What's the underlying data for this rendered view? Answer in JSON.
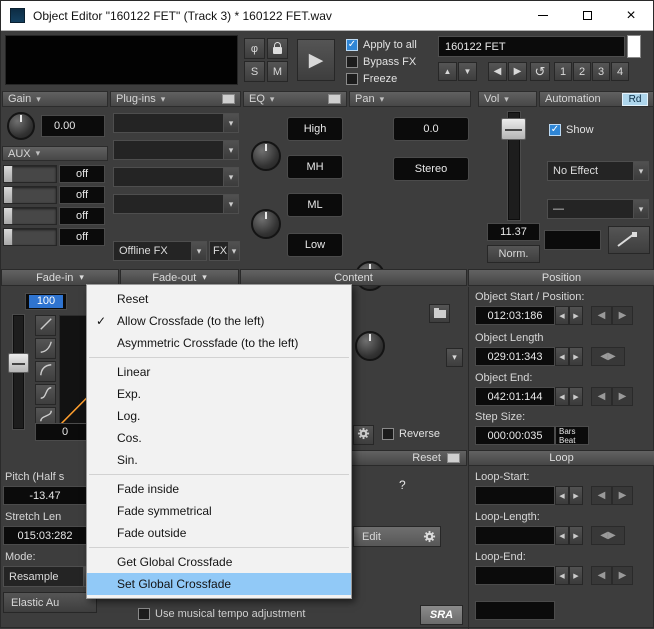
{
  "window": {
    "title": "Object Editor \"160122 FET\"  (Track 3) *   160122 FET.wav"
  },
  "icons": {
    "chevron_down": "▾",
    "check": "✓",
    "play": "▶",
    "arrow_up": "▲",
    "arrow_down": "▼",
    "arrow_left": "◀",
    "arrow_right": "▶",
    "undo": "↺",
    "move_both": "◀▶",
    "close": "×"
  },
  "transport": {
    "phase": "φ",
    "solo": "S",
    "mute": "M",
    "apply_to_all": "Apply to all",
    "bypass_fx": "Bypass FX",
    "freeze": "Freeze",
    "object_name": "160122 FET",
    "presets": [
      "1",
      "2",
      "3",
      "4"
    ]
  },
  "gain": {
    "label": "Gain",
    "value": "0.00"
  },
  "aux": {
    "label": "AUX",
    "sends": [
      "off",
      "off",
      "off",
      "off"
    ]
  },
  "plugins": {
    "label": "Plug-ins",
    "offline_fx": "Offline FX",
    "fx": "FX"
  },
  "eq": {
    "label": "EQ",
    "bands": [
      "High",
      "MH",
      "ML",
      "Low"
    ]
  },
  "pan": {
    "label": "Pan",
    "value": "0.0",
    "mode": "Stereo"
  },
  "vol": {
    "label": "Vol",
    "value": "11.37",
    "norm": "Norm."
  },
  "automation": {
    "label": "Automation",
    "read": "Rd",
    "show": "Show",
    "effect": "No Effect",
    "curve": "—"
  },
  "sections": {
    "fade_in": "Fade-in",
    "fade_out": "Fade-out",
    "content": "Content",
    "position": "Position",
    "loop": "Loop",
    "reset": "Reset"
  },
  "fade": {
    "in_value": "100",
    "out_value": "0",
    "reverse": "Reverse"
  },
  "context_menu": {
    "items": [
      "Reset",
      "Allow Crossfade (to the left)",
      "Asymmetric Crossfade (to the left)",
      "Linear",
      "Exp.",
      "Log.",
      "Cos.",
      "Sin.",
      "Fade inside",
      "Fade symmetrical",
      "Fade outside",
      "Get Global Crossfade",
      "Set Global Crossfade"
    ]
  },
  "position_panel": {
    "object_start_label": "Object Start / Position:",
    "object_start": "012:03:186",
    "object_length_label": "Object Length",
    "object_length": "029:01:343",
    "object_end_label": "Object End:",
    "object_end": "042:01:144",
    "step_size_label": "Step Size:",
    "step_size": "000:00:035",
    "step_unit_top": "Bars",
    "step_unit_bottom": "Beat"
  },
  "loop_panel": {
    "start_label": "Loop-Start:",
    "length_label": "Loop-Length:",
    "end_label": "Loop-End:"
  },
  "timestretch": {
    "pitch_label": "Pitch (Half s",
    "pitch_value": "-13.47",
    "stretch_label": "Stretch Len",
    "stretch_value": "015:03:282",
    "mode_label": "Mode:",
    "mode_value": "Resample",
    "elastic_button": "Elastic Au",
    "tempo_adjust_label": "Use musical tempo adjustment",
    "sra": "SRA",
    "edit": "Edit",
    "help": "?"
  }
}
